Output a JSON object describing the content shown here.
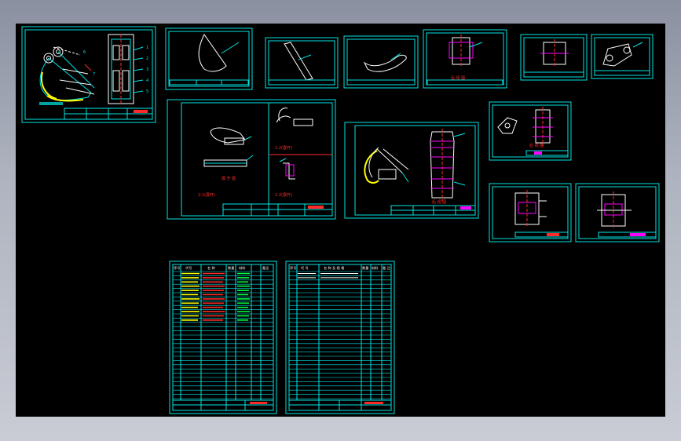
{
  "viewport": {
    "background": "#000000",
    "frame_color": "#b5b9c2",
    "sheet_color": "#00e5e5",
    "accent_colors": {
      "yellow": "#ffff00",
      "magenta": "#ff00ff",
      "red": "#ff2a2a",
      "green": "#00ff40",
      "white": "#ffffff"
    }
  },
  "sheets": [
    {
      "id": "assembly",
      "labels": [
        "1",
        "2",
        "3",
        "4",
        "5",
        "6",
        "7"
      ]
    },
    {
      "id": "part-shell"
    },
    {
      "id": "part-strip"
    },
    {
      "id": "part-curve"
    },
    {
      "id": "part-block",
      "caption": "后 视 图"
    },
    {
      "id": "part-plate"
    },
    {
      "id": "part-ear"
    },
    {
      "id": "part-group",
      "captions": [
        "展 开 图",
        "1:2(展开)",
        "2:1(展开)",
        "1:2(展开)"
      ]
    },
    {
      "id": "part-side",
      "caption": "后 视 图"
    },
    {
      "id": "part-bracket",
      "caption": "后 视 图"
    },
    {
      "id": "part-sleeve"
    },
    {
      "id": "part-bushing"
    }
  ],
  "parts_list": {
    "header": [
      "序号",
      "代号",
      "名 称",
      "数量",
      "材料",
      "备注"
    ]
  },
  "standard_list": {
    "header": [
      "序号",
      "代 号",
      "名 称 及 规 格",
      "数量",
      "材料",
      "备 注"
    ]
  }
}
